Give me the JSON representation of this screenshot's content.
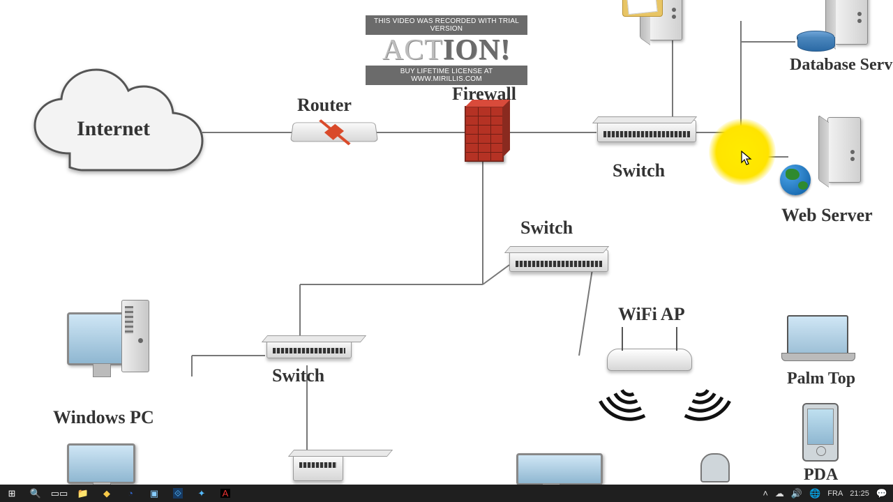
{
  "diagram": {
    "internet": "Internet",
    "router": "Router",
    "firewall": "Firewall",
    "switch_top": "Switch",
    "switch_mid": "Switch",
    "switch_low": "Switch",
    "web_server": "Web Server",
    "database_server": "Database Server",
    "wifi_ap": "WiFi AP",
    "windows_pc": "Windows PC",
    "palm_top": "Palm Top",
    "pda": "PDA"
  },
  "watermark": {
    "top": "THIS VIDEO WAS RECORDED WITH TRIAL VERSION",
    "brand_a": "ACT",
    "brand_b": "ION!",
    "bottom": "BUY LIFETIME LICENSE AT WWW.MIRILLIS.COM"
  },
  "taskbar": {
    "lang": "FRA",
    "time": "21:25"
  }
}
